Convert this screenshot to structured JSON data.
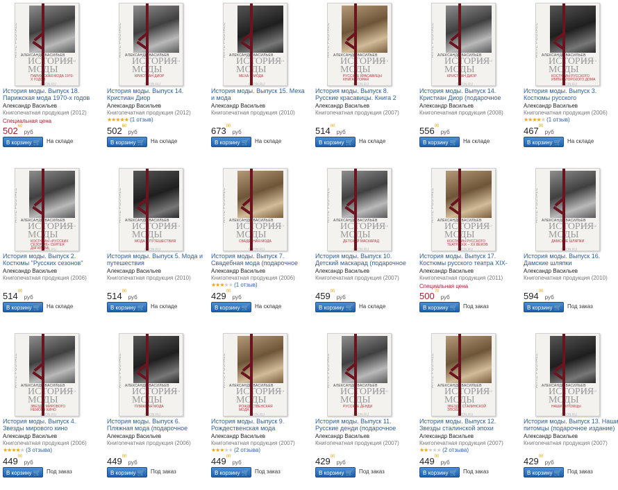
{
  "cover": {
    "author": "АЛЕКСАНДР ВАСИЛЬЕВ",
    "series": "ИСТОРИЯ МОДЫ",
    "spine": "ARTE POSTALE",
    "publisher": "OZON.RU"
  },
  "ui": {
    "cart_label": "В корзину",
    "currency": "руб",
    "special_price_label": "Специальная цена"
  },
  "colors": {
    "link": "#2b5fa6",
    "special": "#b0192e",
    "cart": "#1d5fab",
    "ribbon": "#6b1420",
    "stars": "#f2a400"
  },
  "products": [
    {
      "title": "История моды. Выпуск 18. Парижская мода 1970-х годов",
      "author": "Александр Васильев",
      "category": "Книгопечатная продукция (2012)",
      "special": true,
      "rating_stars": 0,
      "rating_text": "",
      "price": "502",
      "cents": "60",
      "stock": "На складе",
      "cover_sub": "ПАРИЖСКАЯ МОДА 1970-х ГОДОВ",
      "cover_issue": "ВЫПУСК 18",
      "tone": "gray"
    },
    {
      "title": "История моды. Выпуск 14. Кристиан Диор",
      "author": "Александр Васильев",
      "category": "Книгопечатная продукция (2012)",
      "special": false,
      "rating_stars": 5,
      "rating_text": "(1 отзыв)",
      "price": "502",
      "cents": "60",
      "stock": "На складе",
      "cover_sub": "КРИСТИАН ДИОР",
      "cover_issue": "ВЫПУСК 14",
      "tone": "gray"
    },
    {
      "title": "История моды. Выпуск 15. Меха и мода",
      "author": "Александр Васильев",
      "category": "Книгопечатная продукция (2010)",
      "special": false,
      "rating_stars": 0,
      "rating_text": "",
      "price": "673",
      "cents": "00",
      "stock": "На складе",
      "cover_sub": "МЕХА И МОДА",
      "cover_issue": "ВЫПУСК 15",
      "tone": "dark"
    },
    {
      "title": "История моды. Выпуск 8. Русские красавицы. Книга 2 (подарочное",
      "author": "Александр Васильев",
      "category": "Книгопечатная продукция (2007)",
      "special": false,
      "rating_stars": 0,
      "rating_text": "",
      "price": "514",
      "cents": "00",
      "stock": "На складе",
      "cover_sub": "РУССКИЕ КРАСАВИЦЫ КНИГА ВТОРАЯ",
      "cover_issue": "ВЫПУСК 8",
      "tone": "sepia"
    },
    {
      "title": "История моды. Выпуск 14. Кристиан Диор (подарочное издание)",
      "author": "Александр Васильев",
      "category": "Книгопечатная продукция (2008)",
      "special": false,
      "rating_stars": 0,
      "rating_text": "",
      "price": "556",
      "cents": "00",
      "stock": "На складе",
      "cover_sub": "КРИСТИАН ДИОР",
      "cover_issue": "ВЫПУСК 14",
      "tone": "gray"
    },
    {
      "title": "История моды. Выпуск 3. Костюмы русского императорского дома",
      "author": "Александр Васильев",
      "category": "Книгопечатная продукция (2006)",
      "special": false,
      "rating_stars": 4,
      "rating_text": "(1 отзыв)",
      "price": "467",
      "cents": "00",
      "stock": "На складе",
      "cover_sub": "КОСТЮМЫ РУССКОГО ИМПЕРАТОРСКОГО ДОМА",
      "cover_issue": "ВЫПУСК 3",
      "tone": "dark"
    },
    {
      "title": "История моды. Выпуск 2. Костюмы \"Русских сезонов\" Сергея Дягилева",
      "author": "Александр Васильев",
      "category": "Книгопечатная продукция (2006)",
      "special": false,
      "rating_stars": 0,
      "rating_text": "",
      "price": "514",
      "cents": "00",
      "stock": "На складе",
      "cover_sub": "КОСТЮМЫ «РУССКИХ СЕЗОНОВ» СЕРГЕЯ ДЯГИЛЕВА",
      "cover_issue": "ВЫПУСК 2",
      "tone": "gray"
    },
    {
      "title": "История моды. Выпуск 5. Мода и путешествия",
      "author": "Александр Васильев",
      "category": "Книгопечатная продукция (2010)",
      "special": false,
      "rating_stars": 0,
      "rating_text": "",
      "price": "514",
      "cents": "00",
      "stock": "На складе",
      "cover_sub": "МОДА И ПУТЕШЕСТВИЯ",
      "cover_issue": "ВЫПУСК 5",
      "tone": "dark"
    },
    {
      "title": "История моды. Выпуск 7. Свадебная мода (подарочное издание)",
      "author": "Александр Васильев",
      "category": "Книгопечатная продукция (2006)",
      "special": false,
      "rating_stars": 3,
      "rating_text": "(1 отзыв)",
      "price": "429",
      "cents": "00",
      "stock": "На складе",
      "cover_sub": "СВАДЕБНАЯ МОДА",
      "cover_issue": "ВЫПУСК 7",
      "tone": "sepia"
    },
    {
      "title": "История моды. Выпуск 10. Детский маскарад (подарочное издание)",
      "author": "Александр Васильев",
      "category": "Книгопечатная продукция (2007)",
      "special": false,
      "rating_stars": 0,
      "rating_text": "",
      "price": "459",
      "cents": "00",
      "stock": "На складе",
      "cover_sub": "ДЕТСКИЙ МАСКАРАД",
      "cover_issue": "ВЫПУСК 10",
      "tone": "gray"
    },
    {
      "title": "История моды. Выпуск 17. Костюмы русского театра XIX-XX веков",
      "author": "Александр Васильев",
      "category": "Книгопечатная продукция (2011)",
      "special": true,
      "rating_stars": 0,
      "rating_text": "",
      "price": "500",
      "cents": "70",
      "stock": "Под заказ",
      "cover_sub": "КОСТЮМЫ РУССКОГО ТЕАТРА XIX – XX ВЕКОВ",
      "cover_issue": "ВЫПУСК 17",
      "tone": "sepia"
    },
    {
      "title": "История моды. Выпуск 16. Дамские шляпки",
      "author": "Александр Васильев",
      "category": "Книгопечатная продукция (2010)",
      "special": false,
      "rating_stars": 0,
      "rating_text": "",
      "price": "594",
      "cents": "00",
      "stock": "Под заказ",
      "cover_sub": "ДАМСКИЕ ШЛЯПКИ",
      "cover_issue": "ВЫПУСК 16",
      "tone": "gray"
    },
    {
      "title": "История моды. Выпуск 4. Звезды мирового кино (подарочное издание)",
      "author": "Александр Васильев",
      "category": "Книгопечатная продукция (2006)",
      "special": false,
      "rating_stars": 4,
      "rating_text": "(3 отзыва)",
      "price": "449",
      "cents": "00",
      "stock": "Под заказ",
      "cover_sub": "ЗВЕЗДЫ МИРОВОГО НЕМОГО КИНО",
      "cover_issue": "ВЫПУСК 4",
      "tone": "gray"
    },
    {
      "title": "История моды. Выпуск 6. Пляжная мода (подарочное издание)",
      "author": "Александр Васильев",
      "category": "Книгопечатная продукция (2006)",
      "special": false,
      "rating_stars": 0,
      "rating_text": "",
      "price": "449",
      "cents": "00",
      "stock": "Под заказ",
      "cover_sub": "ПЛЯЖНАЯ МОДА",
      "cover_issue": "ВЫПУСК 6",
      "tone": "dark"
    },
    {
      "title": "История моды. Выпуск 9. Рождественская мода (подарочное",
      "author": "Александр Васильев",
      "category": "Книгопечатная продукция (2007)",
      "special": false,
      "rating_stars": 3,
      "rating_text": "(2 отзыва)",
      "price": "449",
      "cents": "00",
      "stock": "Под заказ",
      "cover_sub": "РОЖДЕСТВЕНСКАЯ МОДА",
      "cover_issue": "ВЫПУСК 9",
      "tone": "sepia"
    },
    {
      "title": "История моды. Выпуск 11. Русские денди (подарочное издание)",
      "author": "Александр Васильев",
      "category": "Книгопечатная продукция (2007)",
      "special": false,
      "rating_stars": 0,
      "rating_text": "",
      "price": "429",
      "cents": "00",
      "stock": "Под заказ",
      "cover_sub": "РУССКИЕ ДЕНДИ",
      "cover_issue": "ВЫПУСК 11",
      "tone": "gray"
    },
    {
      "title": "История моды. Выпуск 12. Звезды сталинской эпохи (подарочное",
      "author": "Александр Васильев",
      "category": "Книгопечатная продукция (2007)",
      "special": false,
      "rating_stars": 2,
      "rating_text": "(2 отзыва)",
      "price": "449",
      "cents": "00",
      "stock": "Под заказ",
      "cover_sub": "ЗВЕЗДЫ СТАЛИНСКОЙ ЭПОХИ",
      "cover_issue": "ВЫПУСК 12",
      "tone": "sepia"
    },
    {
      "title": "История моды. Выпуск 13. Наши питомцы (подарочное издание)",
      "author": "Александр Васильев",
      "category": "Книгопечатная продукция (2007)",
      "special": false,
      "rating_stars": 0,
      "rating_text": "",
      "price": "429",
      "cents": "00",
      "stock": "Под заказ",
      "cover_sub": "НАШИ ПИТОМЦЫ",
      "cover_issue": "ВЫПУСК 13",
      "tone": "dark"
    }
  ]
}
